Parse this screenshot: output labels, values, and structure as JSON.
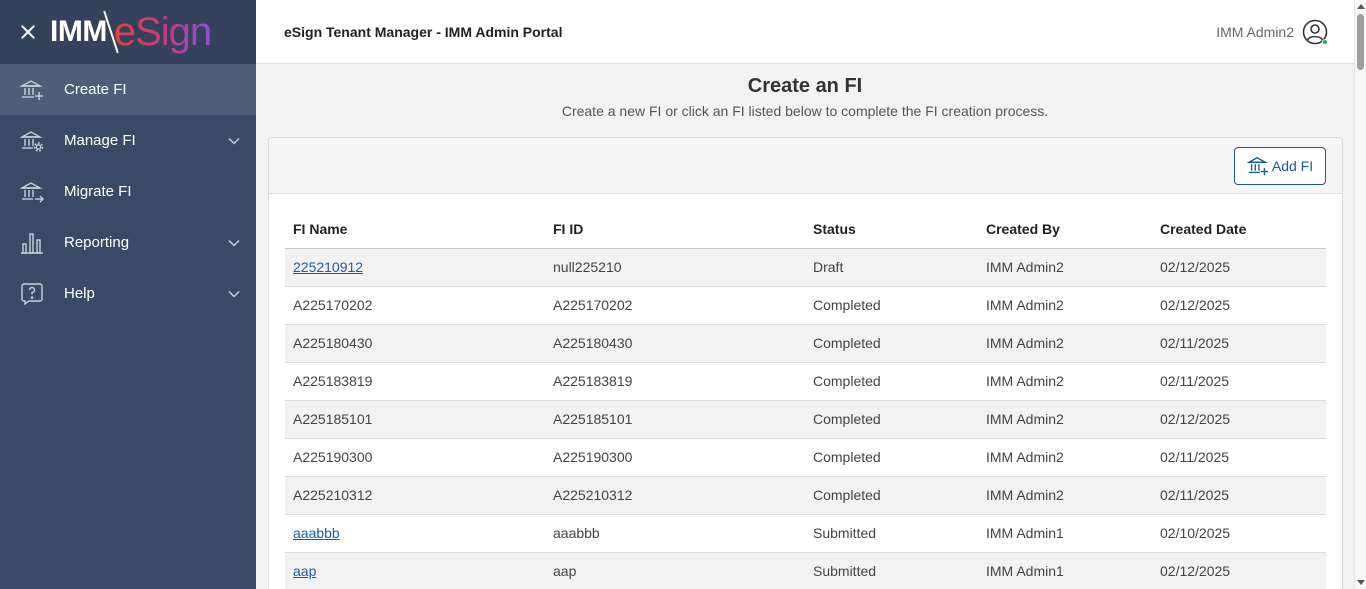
{
  "brand": {
    "logo_imm": "IMM",
    "logo_esign": "eSign"
  },
  "sidebar": {
    "items": [
      {
        "label": "Create FI",
        "icon": "bank-add-icon",
        "active": true,
        "expandable": false
      },
      {
        "label": "Manage FI",
        "icon": "bank-gear-icon",
        "active": false,
        "expandable": true
      },
      {
        "label": "Migrate FI",
        "icon": "bank-arrow-icon",
        "active": false,
        "expandable": false
      },
      {
        "label": "Reporting",
        "icon": "bar-chart-icon",
        "active": false,
        "expandable": true
      },
      {
        "label": "Help",
        "icon": "help-icon",
        "active": false,
        "expandable": true
      }
    ]
  },
  "header": {
    "title": "eSign Tenant Manager - IMM Admin Portal",
    "user_name": "IMM Admin2"
  },
  "main": {
    "title": "Create an FI",
    "subtitle": "Create a new FI or click an FI listed below to complete the FI creation process.",
    "add_button_label": "Add FI",
    "table": {
      "columns": [
        "FI Name",
        "FI ID",
        "Status",
        "Created By",
        "Created Date"
      ],
      "rows": [
        {
          "name": "225210912",
          "link": true,
          "id": "null225210",
          "status": "Draft",
          "created_by": "IMM Admin2",
          "date": "02/12/2025"
        },
        {
          "name": "A225170202",
          "link": false,
          "id": "A225170202",
          "status": "Completed",
          "created_by": "IMM Admin2",
          "date": "02/12/2025"
        },
        {
          "name": "A225180430",
          "link": false,
          "id": "A225180430",
          "status": "Completed",
          "created_by": "IMM Admin2",
          "date": "02/11/2025"
        },
        {
          "name": "A225183819",
          "link": false,
          "id": "A225183819",
          "status": "Completed",
          "created_by": "IMM Admin2",
          "date": "02/11/2025"
        },
        {
          "name": "A225185101",
          "link": false,
          "id": "A225185101",
          "status": "Completed",
          "created_by": "IMM Admin2",
          "date": "02/12/2025"
        },
        {
          "name": "A225190300",
          "link": false,
          "id": "A225190300",
          "status": "Completed",
          "created_by": "IMM Admin2",
          "date": "02/11/2025"
        },
        {
          "name": "A225210312",
          "link": false,
          "id": "A225210312",
          "status": "Completed",
          "created_by": "IMM Admin2",
          "date": "02/11/2025"
        },
        {
          "name": "aaabbb",
          "link": true,
          "id": "aaabbb",
          "status": "Submitted",
          "created_by": "IMM Admin1",
          "date": "02/10/2025"
        },
        {
          "name": "aap",
          "link": true,
          "id": "aap",
          "status": "Submitted",
          "created_by": "IMM Admin1",
          "date": "02/12/2025"
        }
      ]
    }
  },
  "colors": {
    "sidebar_bg": "#3a4a66",
    "sidebar_active": "#4f5e78",
    "link": "#1a5fa8",
    "button_border": "#1b5a8c",
    "status_online": "#2eaa52"
  }
}
